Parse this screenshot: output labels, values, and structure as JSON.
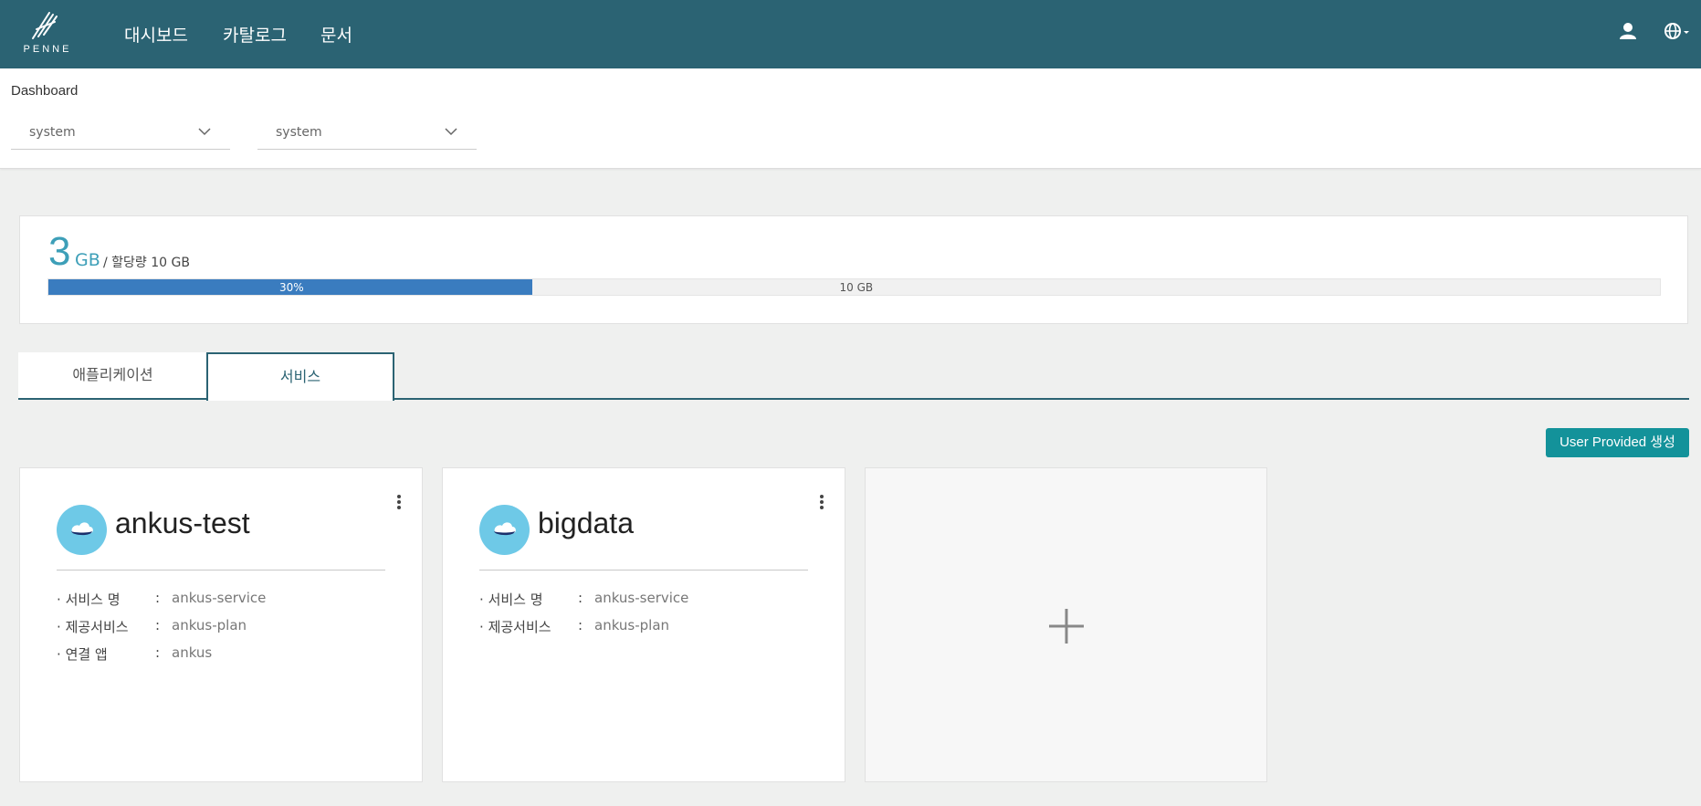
{
  "nav": {
    "logo_text": "PENNE",
    "items": [
      {
        "label": "대시보드"
      },
      {
        "label": "카탈로그"
      },
      {
        "label": "문서"
      }
    ],
    "user_icon": "user-icon",
    "globe_icon": "globe-icon"
  },
  "header": {
    "title": "Dashboard",
    "select_org": "system",
    "select_space": "system"
  },
  "quota": {
    "used_value": "3",
    "used_unit": "GB",
    "alloc_text": "/ 할당량 10 GB",
    "percent_label": "30%",
    "percent": 0.3,
    "total_label": "10 GB"
  },
  "tabs": {
    "app": "애플리케이션",
    "service": "서비스"
  },
  "actions": {
    "create_label": "User Provided 생성"
  },
  "labels": {
    "service_name": "서비스 명",
    "provider": "제공서비스",
    "bound_app": "연결 앱",
    "colon": ":",
    "bullet": "·"
  },
  "cards": [
    {
      "name": "ankus-test",
      "service_name": "ankus-service",
      "provider": "ankus-plan",
      "bound_app": "ankus"
    },
    {
      "name": "bigdata",
      "service_name": "ankus-service",
      "provider": "ankus-plan"
    }
  ],
  "colors": {
    "nav_bg": "#2b6373",
    "accent": "#3d9fb8",
    "bar_fill": "#3a7cbf",
    "button": "#13929a",
    "avatar": "#6ec9e7"
  }
}
